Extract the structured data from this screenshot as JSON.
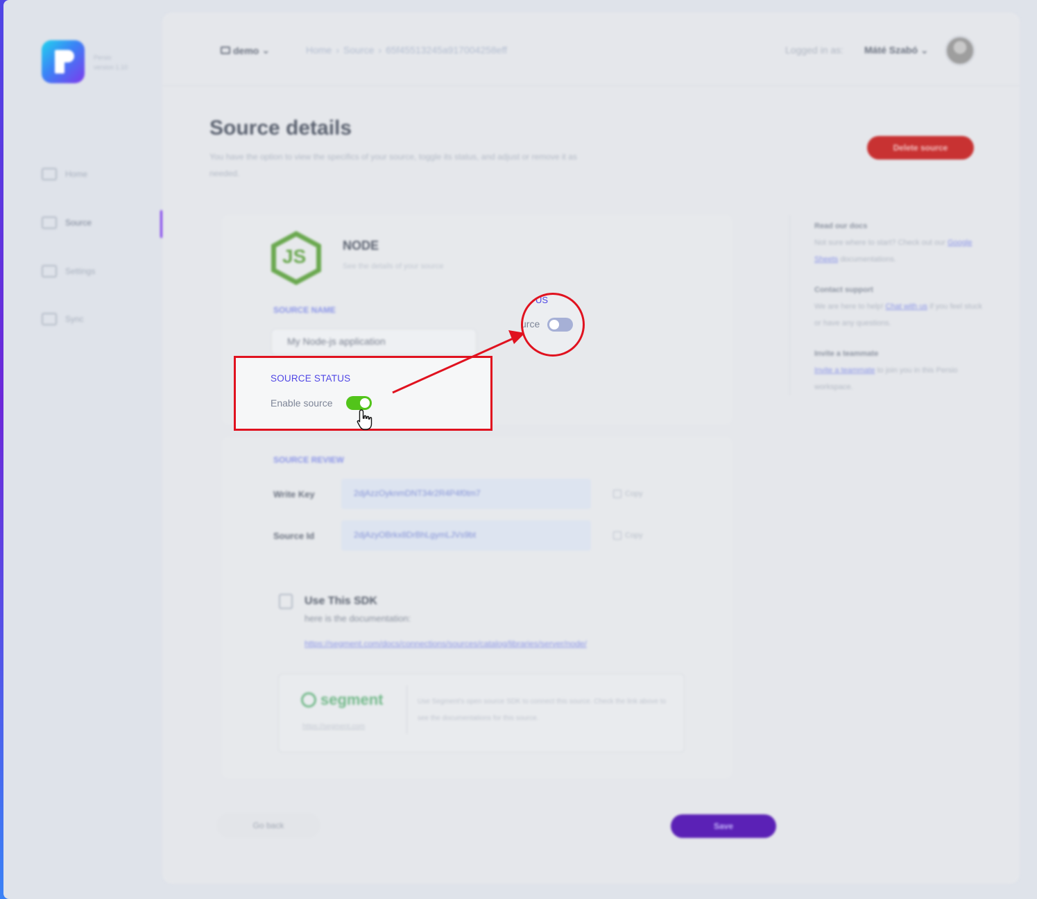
{
  "sidebar": {
    "app_name": "Persio",
    "version": "version 1.10",
    "items": [
      {
        "label": "Home",
        "icon": "home-icon"
      },
      {
        "label": "Source",
        "icon": "source-icon",
        "active": true
      },
      {
        "label": "Settings",
        "icon": "settings-icon"
      },
      {
        "label": "Sync",
        "icon": "sync-icon"
      }
    ]
  },
  "header": {
    "workspace": "demo",
    "breadcrumb": [
      "Home",
      "Source",
      "65f45513245a917004258eff"
    ],
    "logged_in_label": "Logged in as:",
    "user_name": "Máté Szabó"
  },
  "page": {
    "title": "Source details",
    "subtitle": "You have the option to view the specifics of your source, toggle its status, and adjust or remove it as needed.",
    "delete_label": "Delete source"
  },
  "source": {
    "name": "NODE",
    "logo_text": "JS",
    "subtitle": "See the details of your source",
    "name_label": "SOURCE NAME",
    "name_value": "My Node-js application",
    "status_label": "SOURCE STATUS",
    "enable_label": "Enable source",
    "enabled": true
  },
  "review": {
    "label": "SOURCE REVIEW",
    "write_key_label": "Write Key",
    "write_key": "2djAzzOyknmDNT34r2R4P4f0tm7",
    "source_id_label": "Source Id",
    "source_id": "2djAzyOBrkx8DrBhLgymLJVs9bt",
    "copy_label": "Copy"
  },
  "sdk": {
    "title": "Use This SDK",
    "subtitle": "here is the documentation:",
    "link": "https://segment.com/docs/connections/sources/catalog/libraries/server/node/",
    "vendor": "segment",
    "vendor_url": "https://segment.com",
    "vendor_desc": "Use Segment's open source SDK to connect this source. Check the link above to see the documentations for this source."
  },
  "help": {
    "docs_title": "Read our docs",
    "docs_text": "Not sure where to start? Check out our",
    "docs_link": "Google Sheets",
    "docs_tail": "documentations.",
    "support_title": "Contact support",
    "support_text": "We are here to help!",
    "support_link": "Chat with us",
    "support_tail": "if you feel stuck or have any questions.",
    "invite_title": "Invite a teammate",
    "invite_link": "Invite a teammate",
    "invite_tail": "to join you in this Persio workspace."
  },
  "footer": {
    "back_label": "Go back",
    "save_label": "Save"
  },
  "zoom": {
    "status_fragment": "US",
    "enable_fragment": "urce",
    "enabled": false
  },
  "colors": {
    "accent": "#7c3aed",
    "delete": "#c83232",
    "toggle_on": "#52c41a",
    "highlight": "#e0121f"
  }
}
